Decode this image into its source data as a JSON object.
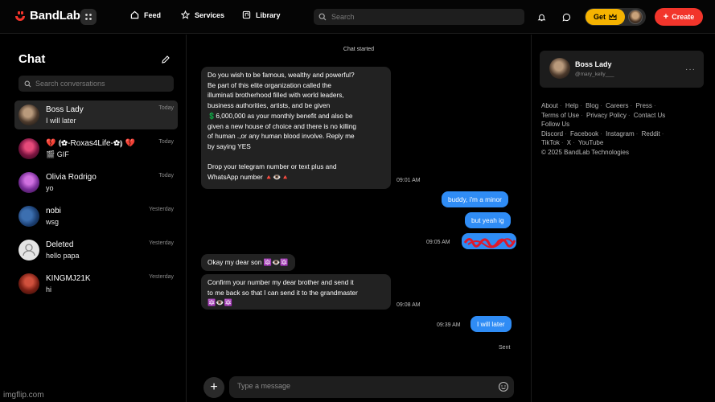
{
  "app": {
    "name": "BandLab"
  },
  "nav": {
    "feed": "Feed",
    "services": "Services",
    "library": "Library"
  },
  "search": {
    "placeholder": "Search"
  },
  "header": {
    "get_label": "Get",
    "create_label": "Create"
  },
  "sidebar": {
    "title": "Chat",
    "search_placeholder": "Search conversations",
    "conversations": [
      {
        "name": "Boss Lady",
        "preview": "I will later",
        "time": "Today"
      },
      {
        "name": "💔 ⟬✿-Roxas4Life-✿⟭ 💔",
        "preview": "🎬 GIF",
        "time": "Today"
      },
      {
        "name": "Olivia Rodrigo",
        "preview": "yo",
        "time": "Today"
      },
      {
        "name": "nobi",
        "preview": "wsg",
        "time": "Yesterday"
      },
      {
        "name": "Deleted",
        "preview": "hello papa",
        "time": "Yesterday"
      },
      {
        "name": "KINGMJ21K",
        "preview": "hi",
        "time": "Yesterday"
      }
    ]
  },
  "chat": {
    "status": "Chat started",
    "messages": [
      {
        "from": "them",
        "text": "Do you wish to be famous, wealthy and powerful?\nBe part of this elite organization called the\nilluminati brotherhood filled with world leaders,\nbusiness authorities, artists, and be given\n💲6,000,000 as your monthly benefit and also be\ngiven a new house of choice and there is no killing\nof human .,or any human blood involve. Reply me\nby saying YES\n\nDrop your telegram number or text plus and\nWhatsApp number 🔺👁️🔺",
        "time": "09:01 AM"
      },
      {
        "from": "me",
        "text": "buddy, i'm a minor"
      },
      {
        "from": "me",
        "text": "but yeah ig"
      },
      {
        "from": "me",
        "text": "",
        "time": "09:05 AM"
      },
      {
        "from": "them",
        "text": "Okay my dear son 🔯👁️🔯"
      },
      {
        "from": "them",
        "text": "Confirm your number my dear brother and send it\nto me back so that I can send it to the grandmaster\n🔯👁️🔯",
        "time": "09:08 AM"
      },
      {
        "from": "me",
        "text": "I will later",
        "time": "09:39 AM"
      }
    ],
    "sent_status": "Sent",
    "composer_placeholder": "Type a message"
  },
  "profile": {
    "name": "Boss Lady",
    "handle": "@mary_kelly___"
  },
  "footer": {
    "row1": [
      "About",
      "Help",
      "Blog",
      "Careers",
      "Press"
    ],
    "row2": [
      "Terms of Use",
      "Privacy Policy",
      "Contact Us"
    ],
    "follow_label": "Follow Us",
    "row3": [
      "Discord",
      "Facebook",
      "Instagram",
      "Reddit"
    ],
    "row4": [
      "TikTok",
      "X",
      "YouTube"
    ],
    "copyright": "© 2025 BandLab Technologies"
  },
  "watermark": "imgflip.com",
  "colors": {
    "accent": "#f2352b",
    "bubble_out": "#2f8cf5",
    "get_pill": "#f5b301"
  }
}
